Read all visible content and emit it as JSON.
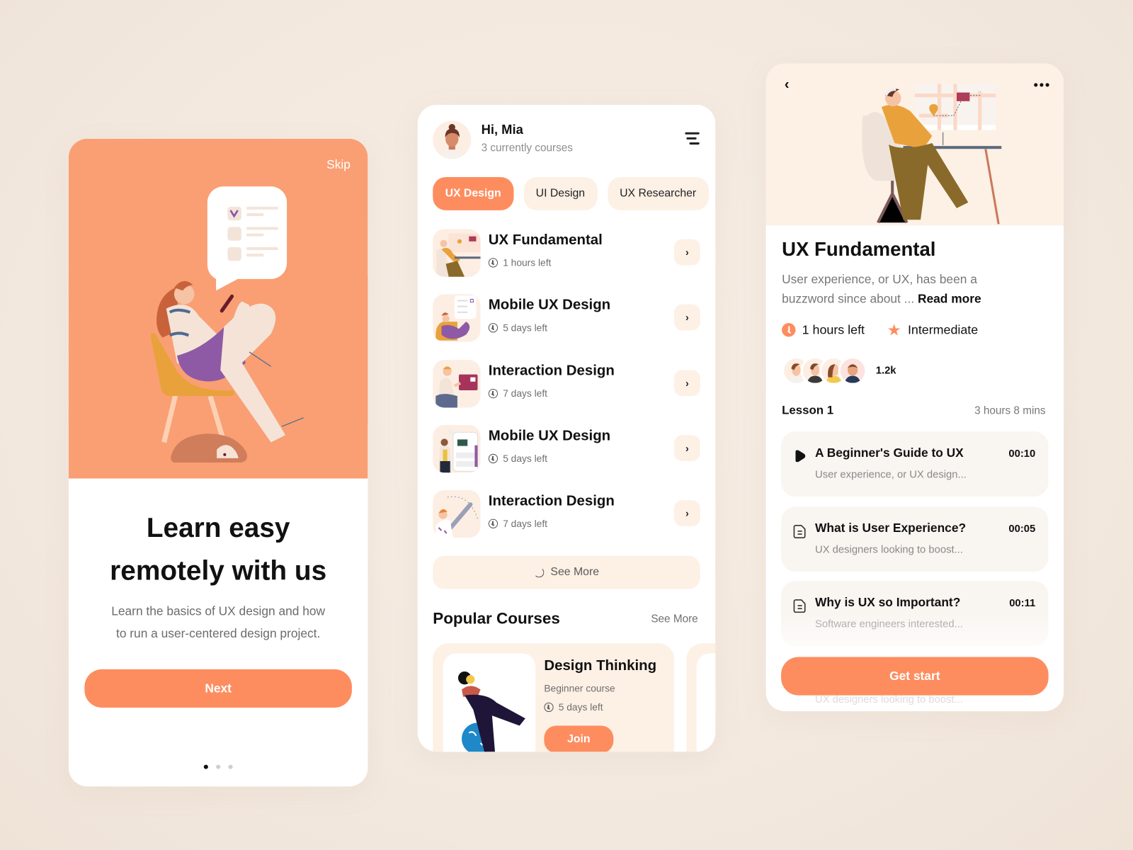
{
  "onboarding": {
    "skip_label": "Skip",
    "title_line1": "Learn easy",
    "title_line2": "remotely with us",
    "subtitle_line1": "Learn the basics of UX design and how",
    "subtitle_line2": "to run a user-centered design project.",
    "next_label": "Next",
    "pagination": {
      "total": 3,
      "active": 1
    }
  },
  "home": {
    "greeting": "Hi, Mia",
    "subtitle": "3 currently courses",
    "menu_icon": "filter-menu-icon",
    "categories": [
      {
        "label": "UX Design",
        "active": true
      },
      {
        "label": "UI Design",
        "active": false
      },
      {
        "label": "UX Researcher",
        "active": false
      }
    ],
    "courses": [
      {
        "name": "UX Fundamental",
        "time_left": "1 hours left"
      },
      {
        "name": "Mobile UX Design",
        "time_left": "5 days left"
      },
      {
        "name": "Interaction Design",
        "time_left": "7 days left"
      },
      {
        "name": "Mobile UX Design",
        "time_left": "5 days left"
      },
      {
        "name": "Interaction Design",
        "time_left": "7 days left"
      }
    ],
    "see_more_button": "See More",
    "popular": {
      "title": "Popular Courses",
      "see_more": "See More",
      "card": {
        "name": "Design Thinking",
        "level": "Beginner course",
        "time_left": "5 days left",
        "join_label": "Join"
      }
    }
  },
  "detail": {
    "title": "UX Fundamental",
    "description": "User experience, or UX, has been a buzzword since about ...",
    "read_more": "Read more",
    "time_left": "1 hours left",
    "level": "Intermediate",
    "enrolled_count": "1.2k",
    "lesson_heading": "Lesson 1",
    "lesson_duration": "3 hours 8 mins",
    "lessons": [
      {
        "title": "A Beginner's Guide to UX",
        "subtitle": "User experience, or UX design...",
        "time": "00:10",
        "icon": "play-icon"
      },
      {
        "title": "What is User Experience?",
        "subtitle": "UX designers looking to boost...",
        "time": "00:05",
        "icon": "document-icon"
      },
      {
        "title": "Why is UX so Important?",
        "subtitle": "Software engineers interested...",
        "time": "00:11",
        "icon": "document-icon"
      }
    ],
    "hidden_lesson_subtitle": "UX designers looking to boost...",
    "cta_label": "Get start"
  },
  "colors": {
    "accent": "#fd8d5f",
    "hero_orange": "#f99f73",
    "chip_bg": "#fdf0e5",
    "page_bg": "#f4eae1"
  }
}
